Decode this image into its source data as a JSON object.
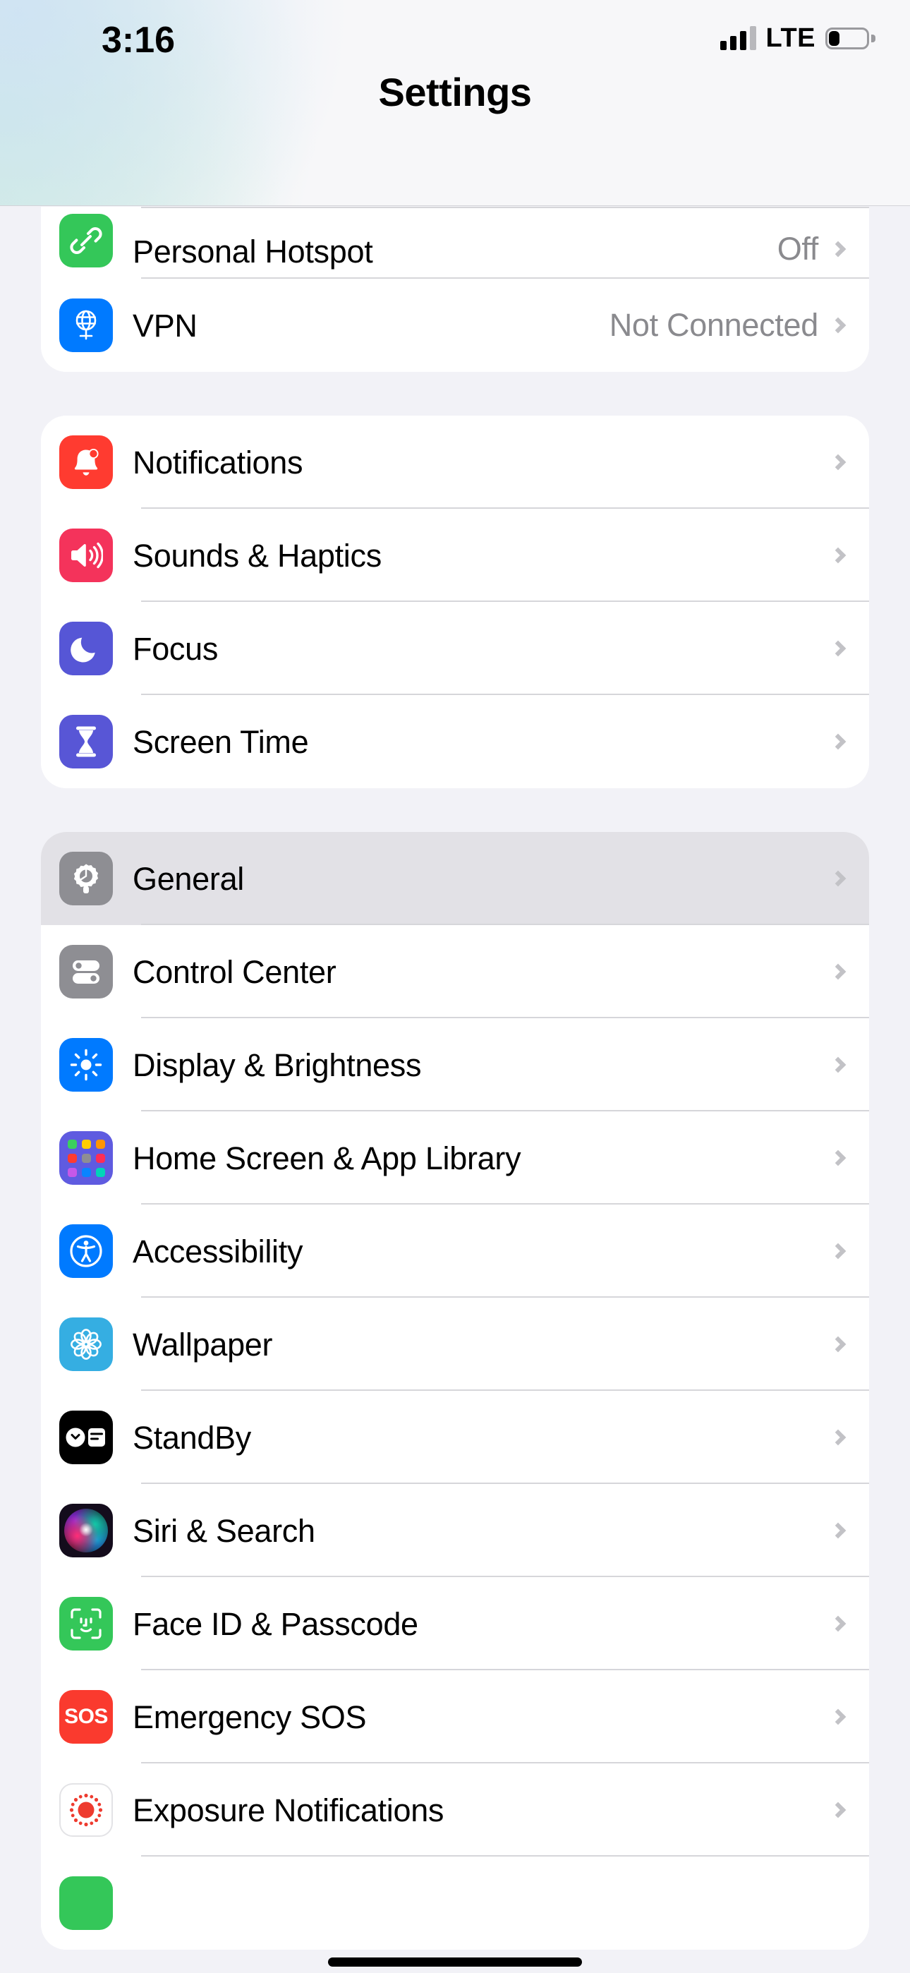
{
  "status_bar": {
    "time": "3:16",
    "network_type": "LTE",
    "signal_bars_filled": 3,
    "signal_bars_total": 4,
    "battery_level_percent": 20,
    "battery_icon": "battery-low-icon",
    "signal_icon": "cellular-signal-icon"
  },
  "nav": {
    "title": "Settings"
  },
  "sections": [
    {
      "id": "connectivity",
      "clipped_top": true,
      "rows": [
        {
          "label": "Personal Hotspot",
          "value": "Off",
          "icon": "personal-hotspot-icon",
          "icon_class": "ic-hotspot",
          "pressed": false,
          "partial": true
        },
        {
          "label": "VPN",
          "value": "Not Connected",
          "icon": "vpn-icon",
          "icon_class": "ic-vpn",
          "pressed": false,
          "partial": false
        }
      ]
    },
    {
      "id": "alerts",
      "clipped_top": false,
      "rows": [
        {
          "label": "Notifications",
          "value": "",
          "icon": "notifications-bell-icon",
          "icon_class": "ic-notif",
          "pressed": false,
          "partial": false
        },
        {
          "label": "Sounds & Haptics",
          "value": "",
          "icon": "speaker-sound-icon",
          "icon_class": "ic-sounds",
          "pressed": false,
          "partial": false
        },
        {
          "label": "Focus",
          "value": "",
          "icon": "focus-moon-icon",
          "icon_class": "ic-focus",
          "pressed": false,
          "partial": false
        },
        {
          "label": "Screen Time",
          "value": "",
          "icon": "screen-time-hourglass-icon",
          "icon_class": "ic-screent",
          "pressed": false,
          "partial": false
        }
      ]
    },
    {
      "id": "system",
      "clipped_top": false,
      "rows": [
        {
          "label": "General",
          "value": "",
          "icon": "general-gear-icon",
          "icon_class": "ic-general",
          "pressed": true,
          "partial": false
        },
        {
          "label": "Control Center",
          "value": "",
          "icon": "control-center-toggles-icon",
          "icon_class": "ic-cc",
          "pressed": false,
          "partial": false
        },
        {
          "label": "Display & Brightness",
          "value": "",
          "icon": "brightness-sun-icon",
          "icon_class": "ic-display",
          "pressed": false,
          "partial": false
        },
        {
          "label": "Home Screen & App Library",
          "value": "",
          "icon": "home-screen-grid-icon",
          "icon_class": "ic-home",
          "pressed": false,
          "partial": false
        },
        {
          "label": "Accessibility",
          "value": "",
          "icon": "accessibility-person-icon",
          "icon_class": "ic-access",
          "pressed": false,
          "partial": false
        },
        {
          "label": "Wallpaper",
          "value": "",
          "icon": "wallpaper-flower-icon",
          "icon_class": "ic-wall",
          "pressed": false,
          "partial": false
        },
        {
          "label": "StandBy",
          "value": "",
          "icon": "standby-clock-widget-icon",
          "icon_class": "ic-standby",
          "pressed": false,
          "partial": false
        },
        {
          "label": "Siri & Search",
          "value": "",
          "icon": "siri-orb-icon",
          "icon_class": "ic-siri",
          "pressed": false,
          "partial": false
        },
        {
          "label": "Face ID & Passcode",
          "value": "",
          "icon": "face-id-icon",
          "icon_class": "ic-faceid",
          "pressed": false,
          "partial": false
        },
        {
          "label": "Emergency SOS",
          "value": "",
          "icon": "emergency-sos-icon",
          "icon_class": "ic-sos",
          "pressed": false,
          "partial": false
        },
        {
          "label": "Exposure Notifications",
          "value": "",
          "icon": "exposure-notifications-icon",
          "icon_class": "ic-expo",
          "pressed": false,
          "partial": false
        },
        {
          "label": "",
          "value": "",
          "icon": "battery-green-icon",
          "icon_class": "ic-battery",
          "pressed": false,
          "partial": false
        }
      ]
    }
  ],
  "home_indicator": {
    "name": "home-indicator"
  },
  "colors": {
    "page_background": "#F2F2F7",
    "row_background": "#FFFFFF",
    "row_pressed": "#E2E1E6",
    "separator": "#D6D6DA",
    "secondary_text": "#8A8A8E",
    "chevron": "#C2C2C6",
    "accent_blue": "#007AFF",
    "accent_green": "#34C759",
    "accent_red": "#FF3B30"
  }
}
